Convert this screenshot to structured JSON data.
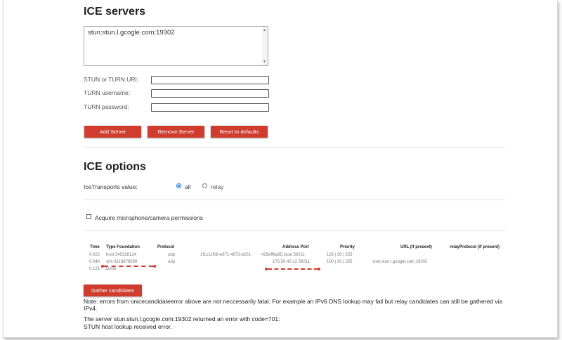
{
  "ice_servers": {
    "heading": "ICE servers",
    "textarea_value": "stun:stun.l.gcogle.com:19302",
    "fields": [
      {
        "label": "STUN or TURN URI:",
        "value": ""
      },
      {
        "label": "TURN username:",
        "value": ""
      },
      {
        "label": "TURN password:",
        "value": ""
      }
    ],
    "buttons": {
      "add": "Add Server",
      "remove": "Remove Server",
      "reset": "Reset to defaults"
    }
  },
  "ice_options": {
    "heading": "ICE options",
    "transport_label": "IceTransports value:",
    "transport_options": [
      "all",
      "relay"
    ],
    "transport_selected": "all",
    "permissions_label": "Acquire microphone/camera permissions",
    "permissions_checked": false
  },
  "candidates_table": {
    "headers": [
      "Time",
      "Type Foundation",
      "Protocol",
      "Address Port",
      "Priority",
      "URL (if present)",
      "relayProtocol (if present)"
    ],
    "rows": [
      {
        "time": "0.022",
        "type_foundation": "host 345328124",
        "protocol": "udp",
        "component": "1f1c11f08-e671-4873-b201-",
        "address_port": "425eff6a95.local 56011",
        "priority": "126 | 30 | 255",
        "url": "",
        "relay_protocol": ""
      },
      {
        "time": "0.046",
        "type_foundation": "srfx 8118878569",
        "protocol": "udp",
        "component": "",
        "address_port": "176.50.40.12 56011",
        "priority": "100 | 30 | 255",
        "url": "stun:stun.l.google.com:19302",
        "relay_protocol": ""
      },
      {
        "time": "0.121",
        "type_foundation": "Done",
        "protocol": "",
        "component": "",
        "address_port": "",
        "priority": "",
        "url": "",
        "relay_protocol": ""
      }
    ]
  },
  "gather_button": "Gather candidates",
  "notes": {
    "line1": "Note: errors from onicecandidateerror above are not neccessarily fatal. For example an IPv6 DNS lookup may fail but relay candidates can still be gathered via IPv4.",
    "line2": "The server stun:stun.l.gcogle.com:19302 returned an error with code=701:",
    "line3": "STUN host lookup received error."
  },
  "colors": {
    "accent": "#d03d2f",
    "radio_selected": "#1a73e8",
    "annotation": "#d33a2e"
  }
}
